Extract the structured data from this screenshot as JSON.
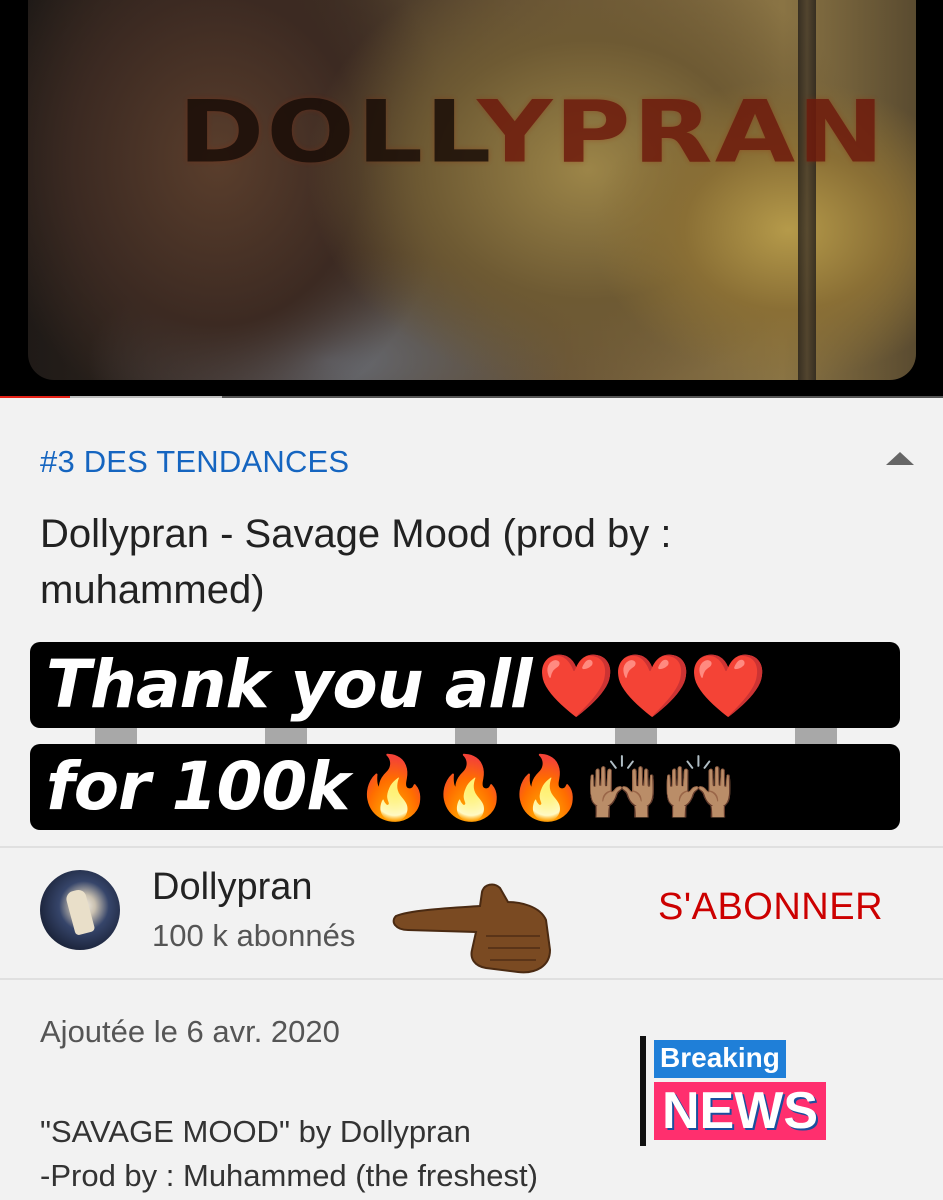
{
  "video": {
    "overlay_title": "DOLLYPRAN",
    "progress": {
      "played_fraction": 0.074,
      "buffered_fraction": 0.235
    }
  },
  "info": {
    "trending_label": "#3 DES TENDANCES",
    "title": "Dollypran - Savage Mood (prod by : muhammed)"
  },
  "story_overlay": {
    "line1": "Thank you all",
    "line1_emoji": "❤️❤️❤️",
    "line2": "for 100k",
    "line2_emoji": "🔥🔥🔥🙌🏽🙌🏽"
  },
  "channel": {
    "name": "Dollypran",
    "subscribers": "100 k abonnés",
    "subscribe_label": "S'ABONNER"
  },
  "description": {
    "added": "Ajoutée le 6 avr. 2020",
    "line1": "\"SAVAGE MOOD\" by Dollypran",
    "line2": "-Prod by : Muhammed (the freshest)"
  },
  "sticker": {
    "top": "Breaking",
    "bottom": "NEWS"
  },
  "colors": {
    "accent_red": "#cc0000",
    "link_blue": "#1565c0",
    "sticker_blue": "#1f7fd8",
    "sticker_pink": "#ff2f6e"
  }
}
